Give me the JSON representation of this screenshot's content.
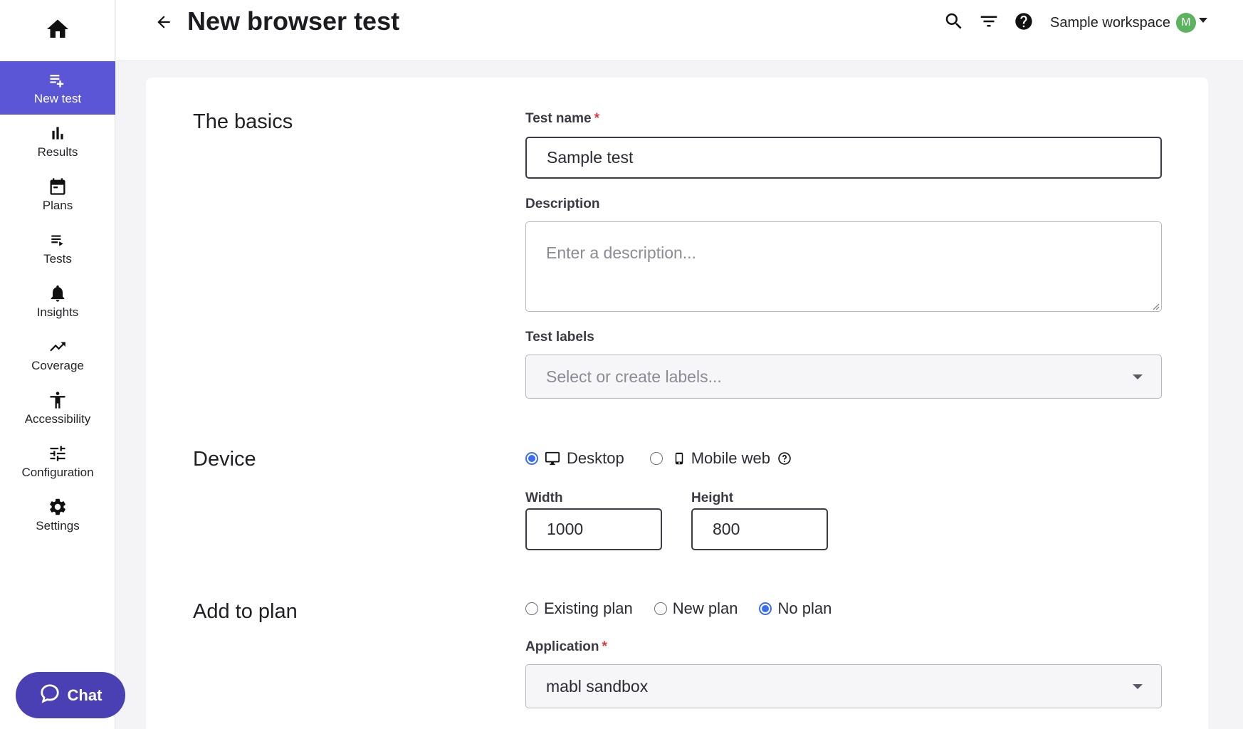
{
  "header": {
    "title": "New browser test",
    "workspace_name": "Sample workspace",
    "avatar_initial": "M"
  },
  "sidebar": {
    "items": [
      {
        "label": "New test",
        "icon": "playlist-add-icon",
        "active": true
      },
      {
        "label": "Results",
        "icon": "bar-chart-icon"
      },
      {
        "label": "Plans",
        "icon": "calendar-icon"
      },
      {
        "label": "Tests",
        "icon": "list-play-icon"
      },
      {
        "label": "Insights",
        "icon": "bell-icon"
      },
      {
        "label": "Coverage",
        "icon": "trending-up-icon"
      },
      {
        "label": "Accessibility",
        "icon": "accessibility-icon"
      },
      {
        "label": "Configuration",
        "icon": "tune-icon"
      },
      {
        "label": "Settings",
        "icon": "gear-icon"
      }
    ],
    "chat_label": "Chat"
  },
  "basics": {
    "section_title": "The basics",
    "test_name_label": "Test name",
    "required_mark": "*",
    "test_name_value": "Sample test",
    "description_label": "Description",
    "description_placeholder": "Enter a description...",
    "labels_label": "Test labels",
    "labels_placeholder": "Select or create labels..."
  },
  "device": {
    "section_title": "Device",
    "options": [
      "Desktop",
      "Mobile web"
    ],
    "selected": "Desktop",
    "width_label": "Width",
    "width_value": "1000",
    "height_label": "Height",
    "height_value": "800"
  },
  "plan": {
    "section_title": "Add to plan",
    "options": [
      "Existing plan",
      "New plan",
      "No plan"
    ],
    "selected": "No plan",
    "application_label": "Application",
    "application_value": "mabl sandbox"
  },
  "colors": {
    "accent": "#5b56d6",
    "chat": "#4a3fb3",
    "radio": "#3a6ef0",
    "avatar": "#5bb35f",
    "required": "#d63c3c"
  }
}
